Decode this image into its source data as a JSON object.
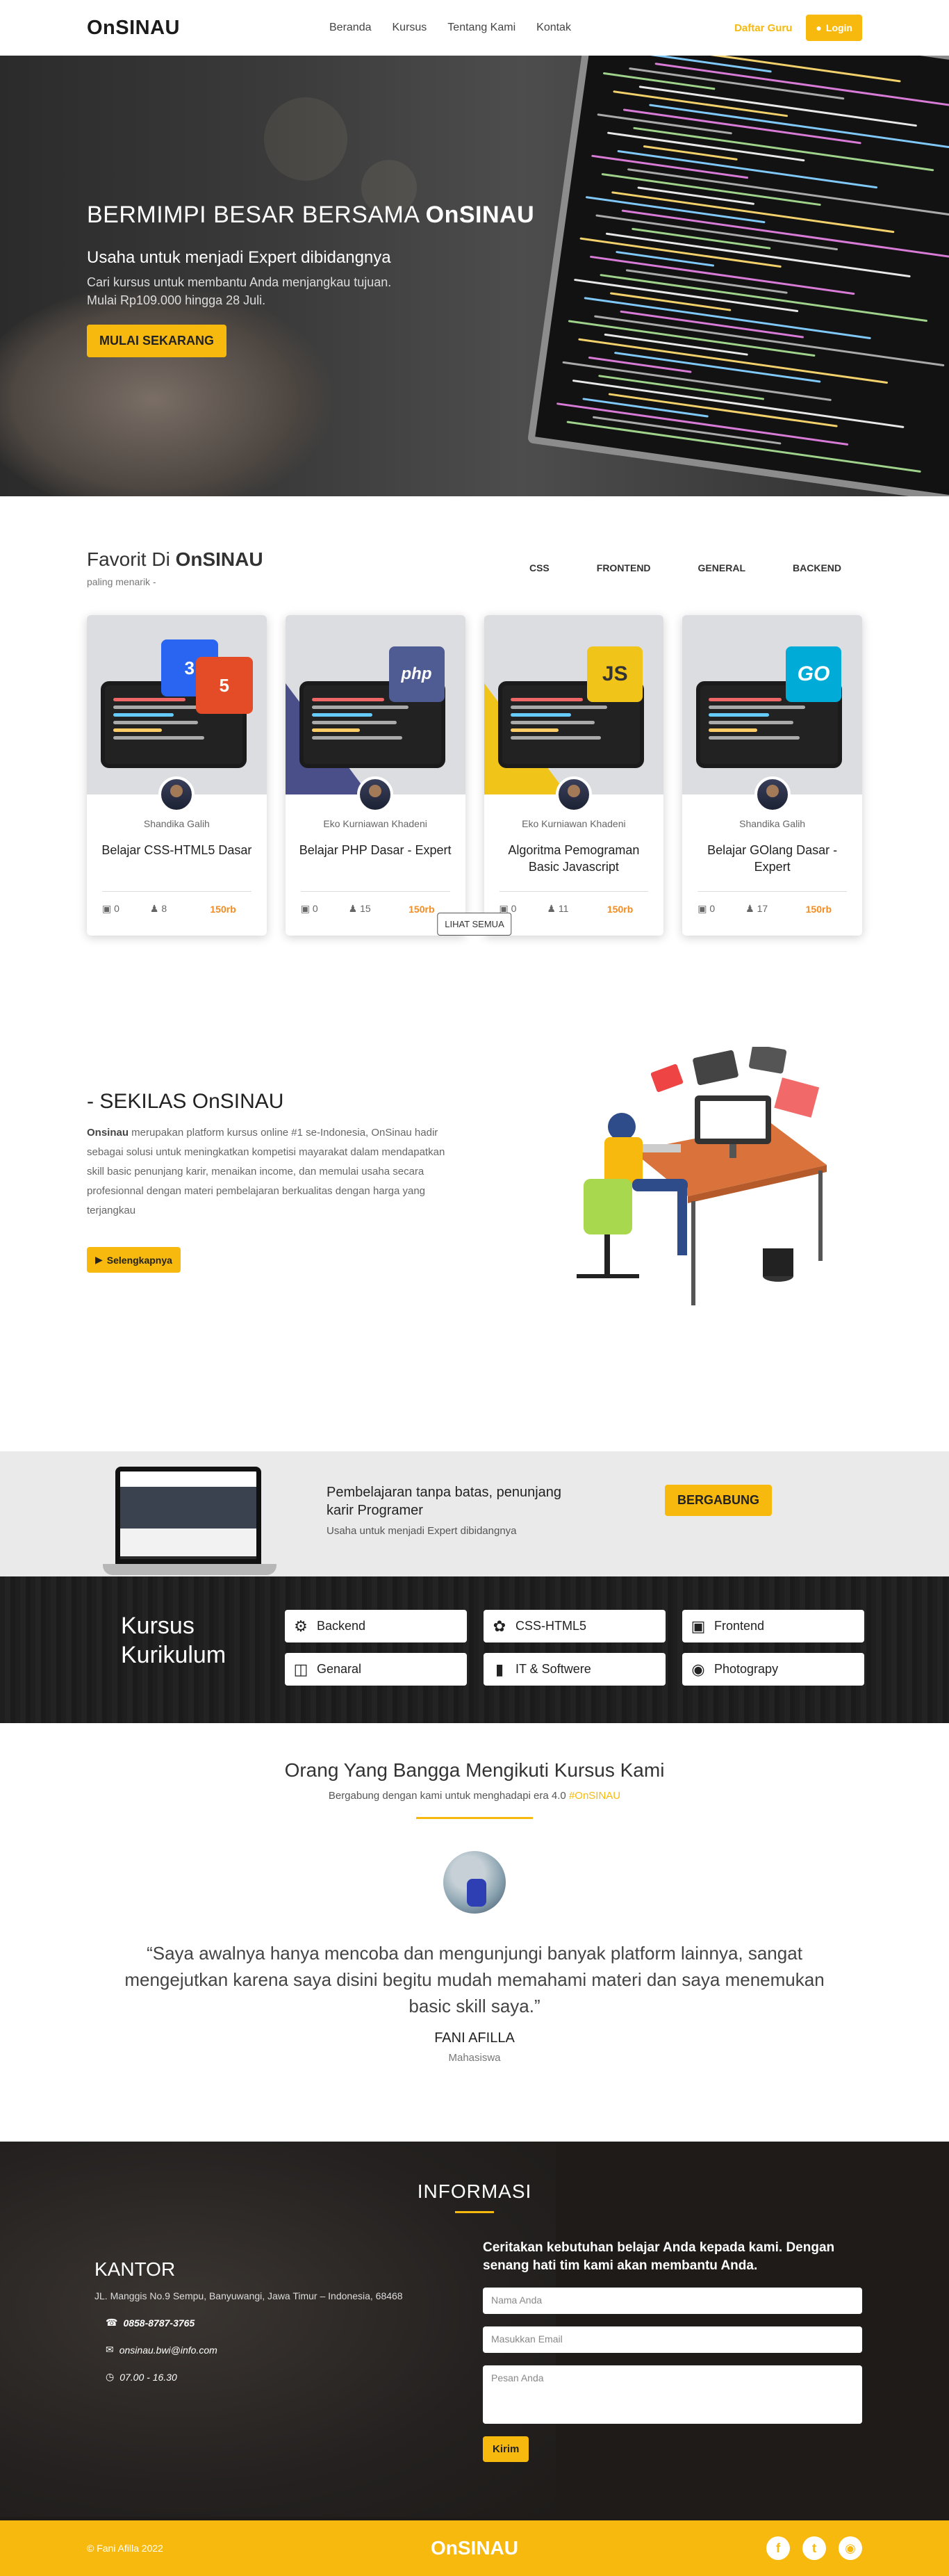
{
  "nav": {
    "logo": "OnSINAU",
    "menu": [
      "Beranda",
      "Kursus",
      "Tentang Kami",
      "Kontak"
    ],
    "daftar": "Daftar Guru",
    "login": "Login"
  },
  "hero": {
    "title_pre": "BERMIMPI BESAR BERSAMA ",
    "title_brand": "OnSINAU",
    "subtitle": "Usaha untuk menjadi Expert dibidangnya",
    "desc1": "Cari kursus untuk membantu Anda menjangkau tujuan.",
    "desc2": "Mulai Rp109.000 hingga 28 Juli.",
    "cta": "MULAI SEKARANG"
  },
  "favorit": {
    "title_pre": "Favorit Di ",
    "title_brand": "OnSINAU",
    "sub": "paling menarik -",
    "tabs": [
      "CSS",
      "FRONTEND",
      "GENERAL",
      "BACKEND"
    ],
    "cards": [
      {
        "author": "Shandika Galih",
        "title": "Belajar CSS-HTML5 Dasar",
        "lessons": "0",
        "students": "8",
        "price": "150rb",
        "badge": "css-html5-icon"
      },
      {
        "author": "Eko Kurniawan Khadeni",
        "title": "Belajar PHP Dasar - Expert",
        "lessons": "0",
        "students": "15",
        "price": "150rb",
        "badge": "php"
      },
      {
        "author": "Eko Kurniawan Khadeni",
        "title": "Algoritma Pemograman Basic Javascript",
        "lessons": "0",
        "students": "11",
        "price": "150rb",
        "badge": "JS"
      },
      {
        "author": "Shandika Galih",
        "title": "Belajar GOlang Dasar - Expert",
        "lessons": "0",
        "students": "17",
        "price": "150rb",
        "badge": "GO"
      }
    ],
    "lihat": "LIHAT SEMUA"
  },
  "sekilas": {
    "title": "- SEKILAS OnSINAU",
    "brand": "Onsinau",
    "body": " merupakan platform kursus online #1 se-Indonesia, OnSinau hadir sebagai solusi untuk meningkatkan kompetisi mayarakat dalam mendapatkan skill basic penunjang karir, menaikan income, dan memulai usaha secara profesionnal dengan materi pembelajaran berkualitas dengan harga yang terjangkau",
    "cta": "Selengkapnya"
  },
  "join": {
    "title": "Pembelajaran tanpa batas, penunjang karir Programer",
    "sub": "Usaha untuk menjadi Expert dibidangnya",
    "cta": "BERGABUNG"
  },
  "kurikulum": {
    "title1": "Kursus",
    "title2": "Kurikulum",
    "items": [
      {
        "label": "Backend",
        "icon": "gear-icon"
      },
      {
        "label": "CSS-HTML5",
        "icon": "palette-icon"
      },
      {
        "label": "Frontend",
        "icon": "monitor-icon"
      },
      {
        "label": "Genaral",
        "icon": "code-window-icon"
      },
      {
        "label": "IT & Softwere",
        "icon": "phone-icon"
      },
      {
        "label": "Photograpy",
        "icon": "camera-icon"
      }
    ]
  },
  "testi": {
    "title": "Orang Yang Bangga Mengikuti Kursus Kami",
    "sub_pre": "Bergabung dengan kami untuk menghadapi era 4.0 ",
    "sub_tag": "#OnSINAU",
    "quote": "“Saya awalnya hanya mencoba dan mengunjungi banyak platform lainnya, sangat mengejutkan karena saya disini begitu mudah memahami materi dan saya menemukan basic skill saya.”",
    "name": "FANI AFILLA",
    "role": "Mahasiswa"
  },
  "info": {
    "title": "INFORMASI",
    "kantor": "KANTOR",
    "address": "JL. Manggis No.9 Sempu, Banyuwangi, Jawa Timur – Indonesia, 68468",
    "phone": "0858-8787-3765",
    "email": "onsinau.bwi@info.com",
    "hours": "07.00 - 16.30",
    "form_title": "Ceritakan kebutuhan belajar Anda kepada kami. Dengan senang hati tim kami akan membantu Anda.",
    "ph_name": "Nama Anda",
    "ph_email": "Masukkan Email",
    "ph_msg": "Pesan Anda",
    "send": "Kirim"
  },
  "footer": {
    "copy": "© Fani Afilla 2022",
    "brand": "OnSINAU"
  },
  "colors": {
    "accent": "#f7b90d",
    "price": "#f68b1f",
    "dark": "#1e1b19"
  }
}
